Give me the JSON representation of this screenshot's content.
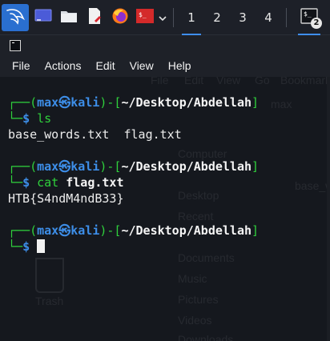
{
  "taskbar": {
    "workspaces": [
      "1",
      "2",
      "3",
      "4"
    ],
    "active_workspace": "1",
    "terminal_badge": "2",
    "accent_color": "#3f8ef0",
    "launcher_color": "#2a6fd0"
  },
  "menubar": {
    "items": [
      "File",
      "Actions",
      "Edit",
      "View",
      "Help"
    ]
  },
  "terminal": {
    "prompt": {
      "user": "max",
      "separator_symbol": "㉿",
      "host": "kali",
      "cwd": "~/Desktop/Abdellah",
      "symbol": "$"
    },
    "blocks": [
      {
        "command_name": "ls",
        "command_args": "",
        "output": "base_words.txt  flag.txt"
      },
      {
        "command_name": "cat",
        "command_args": "flag.txt",
        "output": "HTB{S4ndM4ndB33}"
      }
    ]
  },
  "background_ghost": {
    "items": [
      "File",
      "Edit",
      "View",
      "Go",
      "Bookmarks",
      "max",
      "Computer",
      "base_w",
      "Desktop",
      "Recent",
      "Documents",
      "Music",
      "Pictures",
      "Videos",
      "Downloads",
      "Trash"
    ]
  }
}
